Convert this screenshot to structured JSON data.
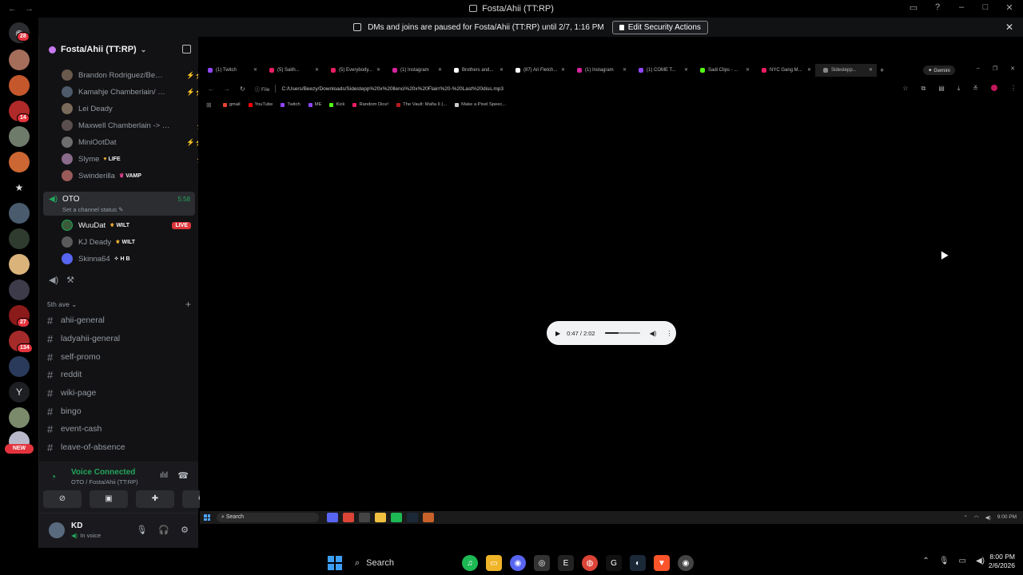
{
  "window": {
    "title": "Fosta/Ahii (TT:RP)"
  },
  "server_rail": {
    "badges": [
      "28",
      "14",
      "27",
      "134"
    ],
    "letter_server": "Y",
    "new_label": "NEW"
  },
  "banner": {
    "text": "DMs and joins are paused for Fosta/Ahii (TT:RP) until 2/7, 1:16 PM",
    "button": "Edit Security Actions"
  },
  "guild": {
    "name": "Fosta/Ahii (TT:RP)"
  },
  "members_top": [
    {
      "name": "Brandon Rodriguez/Benz..."
    },
    {
      "name": "Kamahje Chamberlain/ O..."
    },
    {
      "name": "Lei Deady"
    },
    {
      "name": "Maxwell Chamberlain -> Ma..."
    },
    {
      "name": "MiniOotDat"
    },
    {
      "name": "Slyme",
      "tag": "LIFE"
    },
    {
      "name": "Swinderilla",
      "tag": "VAMP"
    }
  ],
  "voice_channel": {
    "name": "OTO",
    "status": "Set a channel status",
    "timer": "5:58"
  },
  "members_vc": [
    {
      "name": "WuuDat",
      "tag": "WILT",
      "live": "LIVE"
    },
    {
      "name": "KJ Deady",
      "tag": "WILT"
    },
    {
      "name": "Skinna64",
      "tag": "H B"
    }
  ],
  "category": {
    "name": "5th ave"
  },
  "channels": [
    {
      "name": "ahii-general"
    },
    {
      "name": "ladyahii-general"
    },
    {
      "name": "self-promo"
    },
    {
      "name": "reddit"
    },
    {
      "name": "wiki-page"
    },
    {
      "name": "bingo"
    },
    {
      "name": "event-cash"
    },
    {
      "name": "leave-of-absence"
    }
  ],
  "voice_panel": {
    "title": "Voice Connected",
    "subtitle": "OTO / Fosta/Ahii (TT:RP)"
  },
  "user_panel": {
    "name": "KD",
    "status": "In voice"
  },
  "stream": {
    "tabs": [
      {
        "title": "(1) Twitch",
        "color": "#9146ff"
      },
      {
        "title": "(5) Saith...",
        "color": "#e91e63"
      },
      {
        "title": "(5) Everybody...",
        "color": "#e91e63"
      },
      {
        "title": "(1) Instagram",
        "color": "#d6249f"
      },
      {
        "title": "Brothers and...",
        "color": "#ffffff"
      },
      {
        "title": "(87) Ari Fletch...",
        "color": "#ffffff"
      },
      {
        "title": "(1) Instagram",
        "color": "#d6249f"
      },
      {
        "title": "(1) COME T...",
        "color": "#9146ff"
      },
      {
        "title": "Sadi Clips - ...",
        "color": "#53fc18"
      },
      {
        "title": "NYC Gang M...",
        "color": "#e91e63"
      },
      {
        "title": "Sidestepp...",
        "color": "#888888"
      }
    ],
    "gemini": "Gemini",
    "url_scheme": "File",
    "url": "C:/Users/Beezy/Downloads/Sidestepp%20x%20llenci%20x%20Flairr%20-%20Last%20diss.mp3",
    "bookmarks": [
      {
        "title": "gmail",
        "color": "#ea4335"
      },
      {
        "title": "YouTube",
        "color": "#ff0000"
      },
      {
        "title": "Twitch",
        "color": "#9146ff"
      },
      {
        "title": "ME",
        "color": "#9146ff"
      },
      {
        "title": "Kick",
        "color": "#53fc18"
      },
      {
        "title": "Random Dice!",
        "color": "#e91e63"
      },
      {
        "title": "The Vault: Mafia II (...",
        "color": "#b71c1c"
      },
      {
        "title": "Make a Pixel Speec...",
        "color": "#cccccc"
      }
    ],
    "player": {
      "time": "0:47 / 2:02",
      "progress": 0.39
    },
    "taskbar_search": "Search",
    "taskbar_time": "9:00 PM"
  },
  "taskbar": {
    "search": "Search",
    "time": "8:00 PM",
    "date": "2/6/2026"
  }
}
